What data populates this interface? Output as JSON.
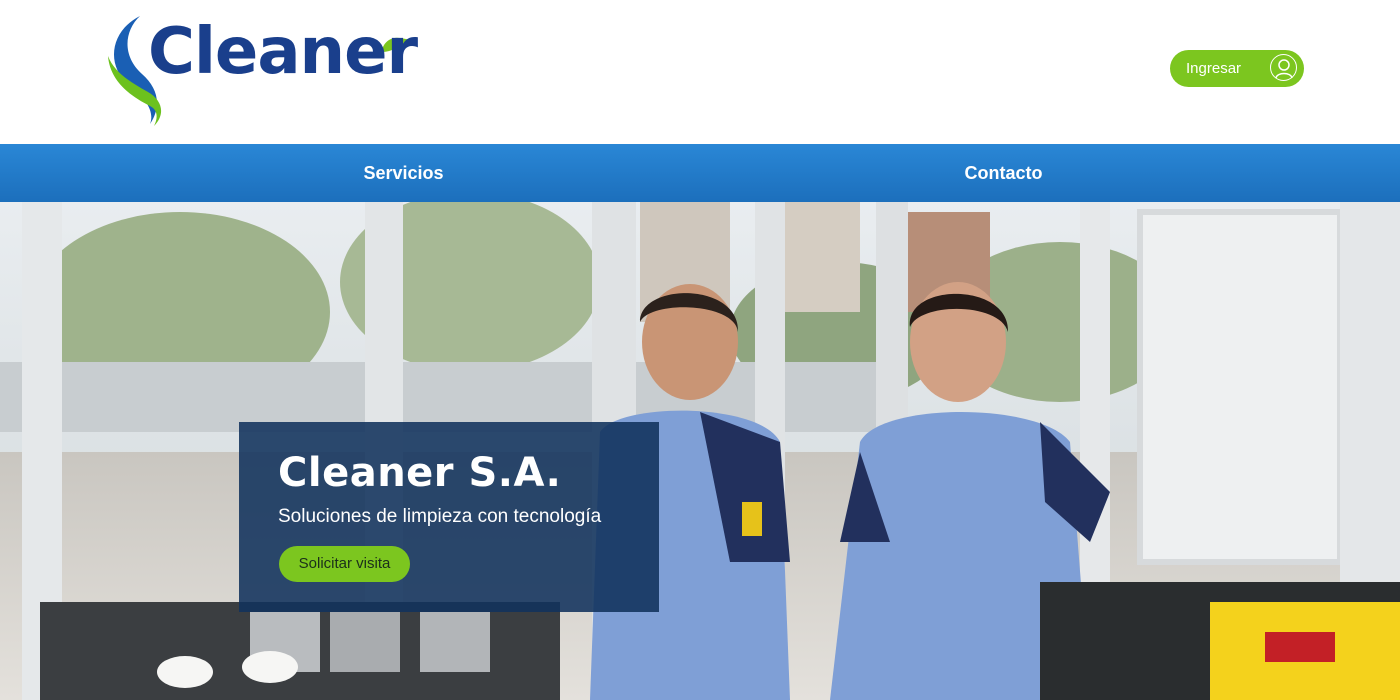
{
  "brand": {
    "logo_text": "Cleaner",
    "colors": {
      "primary_blue": "#1c6fbc",
      "accent_green": "#7cc61f",
      "card_navy": "#11325c"
    }
  },
  "header": {
    "login_label": "Ingresar",
    "login_icon": "user-circle-icon"
  },
  "nav": {
    "items": [
      {
        "label": "Servicios"
      },
      {
        "label": "Contacto"
      }
    ]
  },
  "hero": {
    "title": "Cleaner S.A.",
    "subtitle": "Soluciones de limpieza con tecnología",
    "cta_label": "Solicitar visita"
  }
}
